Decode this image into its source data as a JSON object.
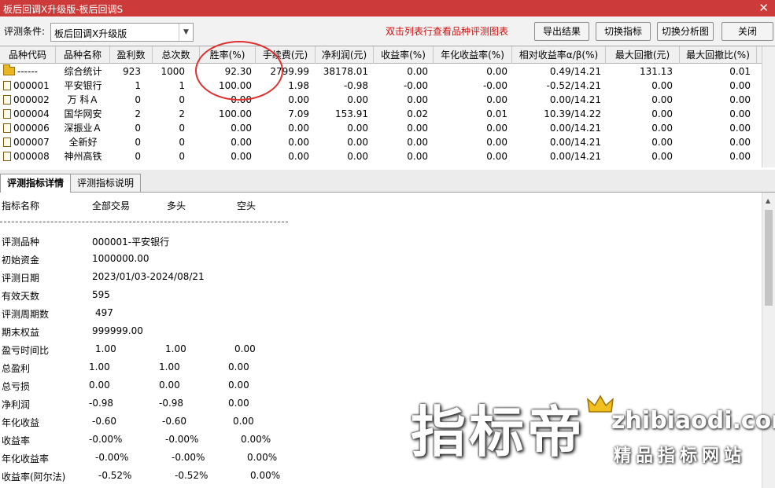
{
  "window": {
    "title": "板后回调X升级版-板后回调S",
    "close_glyph": "✕"
  },
  "toolbar": {
    "condition_label": "评测条件:",
    "condition_value": "板后回调X升级版",
    "hint": "双击列表行查看品种评测图表",
    "buttons": [
      "导出结果",
      "切换指标",
      "切换分析图",
      "关闭"
    ]
  },
  "table": {
    "columns": [
      "品种代码",
      "品种名称",
      "盈利数",
      "总次数",
      "胜率(%)",
      "手续费(元)",
      "净利润(元)",
      "收益率(%)",
      "年化收益率(%)",
      "相对收益率α/β(%)",
      "最大回撤(元)",
      "最大回撤比(%)"
    ],
    "rows": [
      {
        "icon": "folder-icon",
        "cells": [
          "------",
          "综合统计",
          "923",
          "1000",
          "92.30",
          "2799.99",
          "38178.01",
          "0.00",
          "0.00",
          "0.49/14.21",
          "131.13",
          "0.01"
        ]
      },
      {
        "icon": "document-icon",
        "cells": [
          "000001",
          "平安银行",
          "1",
          "1",
          "100.00",
          "1.98",
          "-0.98",
          "-0.00",
          "-0.00",
          "-0.52/14.21",
          "0.00",
          "0.00"
        ]
      },
      {
        "icon": "document-icon",
        "cells": [
          "000002",
          "万 科Ａ",
          "0",
          "0",
          "0.00",
          "0.00",
          "0.00",
          "0.00",
          "0.00",
          "0.00/14.21",
          "0.00",
          "0.00"
        ]
      },
      {
        "icon": "document-icon",
        "cells": [
          "000004",
          "国华网安",
          "2",
          "2",
          "100.00",
          "7.09",
          "153.91",
          "0.02",
          "0.01",
          "10.39/14.22",
          "0.00",
          "0.00"
        ]
      },
      {
        "icon": "document-icon",
        "cells": [
          "000006",
          "深振业Ａ",
          "0",
          "0",
          "0.00",
          "0.00",
          "0.00",
          "0.00",
          "0.00",
          "0.00/14.21",
          "0.00",
          "0.00"
        ]
      },
      {
        "icon": "document-icon",
        "cells": [
          "000007",
          "全新好",
          "0",
          "0",
          "0.00",
          "0.00",
          "0.00",
          "0.00",
          "0.00",
          "0.00/14.21",
          "0.00",
          "0.00"
        ]
      },
      {
        "icon": "document-icon",
        "cells": [
          "000008",
          "神州高铁",
          "0",
          "0",
          "0.00",
          "0.00",
          "0.00",
          "0.00",
          "0.00",
          "0.00/14.21",
          "0.00",
          "0.00"
        ]
      }
    ]
  },
  "tabs": [
    "评测指标详情",
    "评测指标说明"
  ],
  "details": {
    "headers": [
      "指标名称",
      "全部交易",
      "多头",
      "空头"
    ],
    "info": [
      {
        "label": "评测品种",
        "value": "000001-平安银行"
      },
      {
        "label": "初始资金",
        "value": "1000000.00"
      },
      {
        "label": "评测日期",
        "value": "2023/01/03-2024/08/21"
      },
      {
        "label": "有效天数",
        "value": "595"
      },
      {
        "label": "评测周期数",
        "value": "497"
      },
      {
        "label": "期末权益",
        "value": "999999.00"
      }
    ],
    "metrics": [
      {
        "label": "盈亏时间比",
        "all": "1.00",
        "long": "1.00",
        "short": "0.00"
      },
      {
        "label": "总盈利",
        "all": "1.00",
        "long": "1.00",
        "short": "0.00"
      },
      {
        "label": "总亏损",
        "all": "0.00",
        "long": "0.00",
        "short": "0.00"
      },
      {
        "label": "净利润",
        "all": "-0.98",
        "long": "-0.98",
        "short": "0.00"
      },
      {
        "label": "年化收益",
        "all": "-0.60",
        "long": "-0.60",
        "short": "0.00"
      },
      {
        "label": "收益率",
        "all": "-0.00%",
        "long": "-0.00%",
        "short": "0.00%"
      },
      {
        "label": "年化收益率",
        "all": "-0.00%",
        "long": "-0.00%",
        "short": "0.00%"
      },
      {
        "label": "收益率(阿尔法)",
        "all": "-0.52%",
        "long": "-0.52%",
        "short": "0.00%"
      }
    ]
  },
  "watermark": {
    "big": "指标帝",
    "url": "zhibiaodi.com",
    "sub": "精品指标网站"
  },
  "colors": {
    "titlebar": "#cc3a3a",
    "hint": "#d01010",
    "circle": "#e03030"
  }
}
